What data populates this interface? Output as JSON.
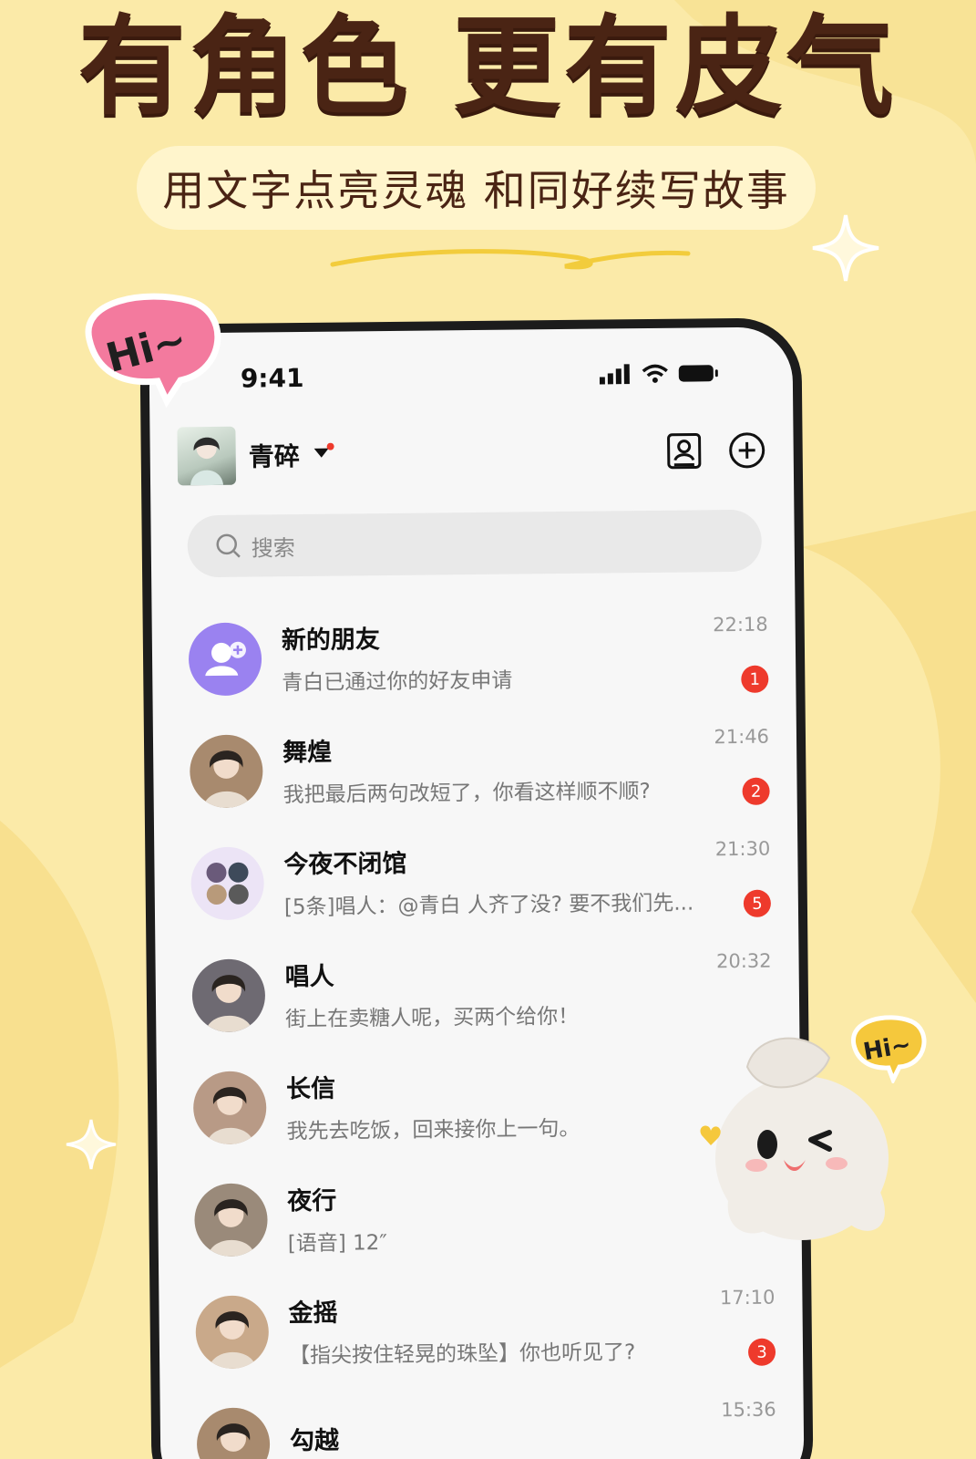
{
  "promo": {
    "headline": "有角色 更有皮气",
    "subtitle": "用文字点亮灵魂  和同好续写故事",
    "hi_left": "Hi~",
    "hi_right": "Hi~"
  },
  "status_bar": {
    "time": "9:41"
  },
  "header": {
    "username": "青碎"
  },
  "search": {
    "placeholder": "搜索"
  },
  "chats": [
    {
      "name": "新的朋友",
      "preview": "青白已通过你的好友申请",
      "time": "22:18",
      "badge": "1",
      "avatar": "new-friends"
    },
    {
      "name": "舞煌",
      "preview": "我把最后两句改短了，你看这样顺不顺?",
      "time": "21:46",
      "badge": "2",
      "avatar": "portrait"
    },
    {
      "name": "今夜不闭馆",
      "preview": "[5条]唱人：@青白 人齐了没? 要不我们先...",
      "time": "21:30",
      "badge": "5",
      "avatar": "group"
    },
    {
      "name": "唱人",
      "preview": "街上在卖糖人呢，买两个给你！",
      "time": "20:32",
      "badge": "",
      "avatar": "portrait"
    },
    {
      "name": "长信",
      "preview": "我先去吃饭，回来接你上一句。",
      "time": "",
      "badge": "",
      "avatar": "portrait"
    },
    {
      "name": "夜行",
      "preview": "[语音] 12″",
      "time": "",
      "badge": "",
      "avatar": "portrait"
    },
    {
      "name": "金摇",
      "preview": "【指尖按住轻晃的珠坠】你也听见了?",
      "time": "17:10",
      "badge": "3",
      "avatar": "portrait"
    },
    {
      "name": "勾越",
      "preview": "",
      "time": "15:36",
      "badge": "",
      "avatar": "portrait"
    }
  ],
  "colors": {
    "background": "#fbeaa8",
    "headline": "#4a2414",
    "badge": "#ee3a2c",
    "new_friend_avatar": "#9a82f0"
  }
}
